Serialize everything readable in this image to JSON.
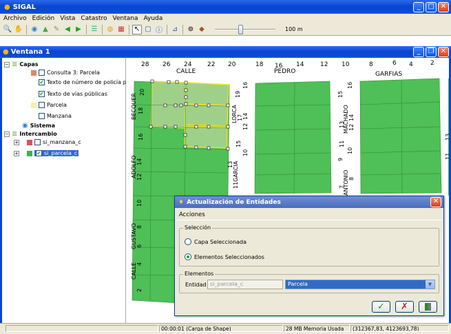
{
  "app": {
    "title": "SIGAL"
  },
  "menu": [
    "Archivo",
    "Edición",
    "Vista",
    "Catastro",
    "Ventana",
    "Ayuda"
  ],
  "toolbar": {
    "scale_label": "100 m",
    "scale_slider_value": 0.42
  },
  "inner_window": {
    "title": "Ventana 1"
  },
  "layers": {
    "capas": "Capas",
    "consulta": "Consulta 3: Parcela",
    "texto_policia": "Texto de número de policía par",
    "texto_vias": "Texto de vías públicas",
    "parcela": "Parcela",
    "manzana": "Manzana",
    "sistema": "Sistema",
    "intercambio": "Intercambio",
    "si_manzana": "si_manzana_c",
    "si_parcela": "si_parcela_c"
  },
  "colors": {
    "accent": "#0a46d4",
    "parcel_green": "#4fbf57",
    "selected_fill": "#9fd08a",
    "selection_outline": "#f5e11a"
  },
  "map_labels": {
    "top_numbers": [
      "28",
      "26",
      "24",
      "22",
      "20",
      "18",
      "16",
      "14",
      "12",
      "10",
      "8",
      "6",
      "4",
      "2"
    ],
    "calle": "CALLE",
    "pedro": "PEDRO",
    "garfias": "GARFIAS",
    "becquer": "BECQUER",
    "lorca": "LORCA",
    "machado": "MACHADO",
    "adolfo": "ADOLFO",
    "garcia": "GARCIA",
    "antonio": "ANTONIO",
    "gustavo": "GUSTAVO",
    "calle2": "CALLE",
    "n20": "20",
    "n18a": "18",
    "n16a": "16",
    "n14a": "14",
    "n12a": "12",
    "n10a": "10",
    "n8a": "8",
    "n6a": "6",
    "n4a": "4",
    "n2a": "2",
    "n19": "19",
    "n17": "17",
    "n15": "15",
    "n13": "13",
    "n11": "11",
    "n16b": "16",
    "n14b": "14",
    "n12b": "12",
    "n10b": "10",
    "n15r": "15",
    "n13r": "13",
    "n11r": "11",
    "n9r": "9",
    "n7r": "7",
    "n16r": "16",
    "n14r": "14",
    "n12r": "12",
    "n10r": "10",
    "n8r": "8",
    "edge11": "11",
    "edge13": "13"
  },
  "dialog": {
    "title": "Actualización de Entidades",
    "menu": "Acciones",
    "group_seleccion": "Selección",
    "radio_capa": "Capa Seleccionada",
    "radio_elementos": "Elementos Seleccionados",
    "group_elementos": "Elementos",
    "entidad_label": "Entidad",
    "entidad_value": "si_parcela_c",
    "entidad_select": "Parcela",
    "ok_symbol": "✓",
    "cancel_symbol": "✗"
  },
  "status": {
    "time": "00:00:01 (Carga de Shape)",
    "memory": "28 MB Memoria Usada",
    "coords": "(312367,83, 4123693,78)"
  }
}
